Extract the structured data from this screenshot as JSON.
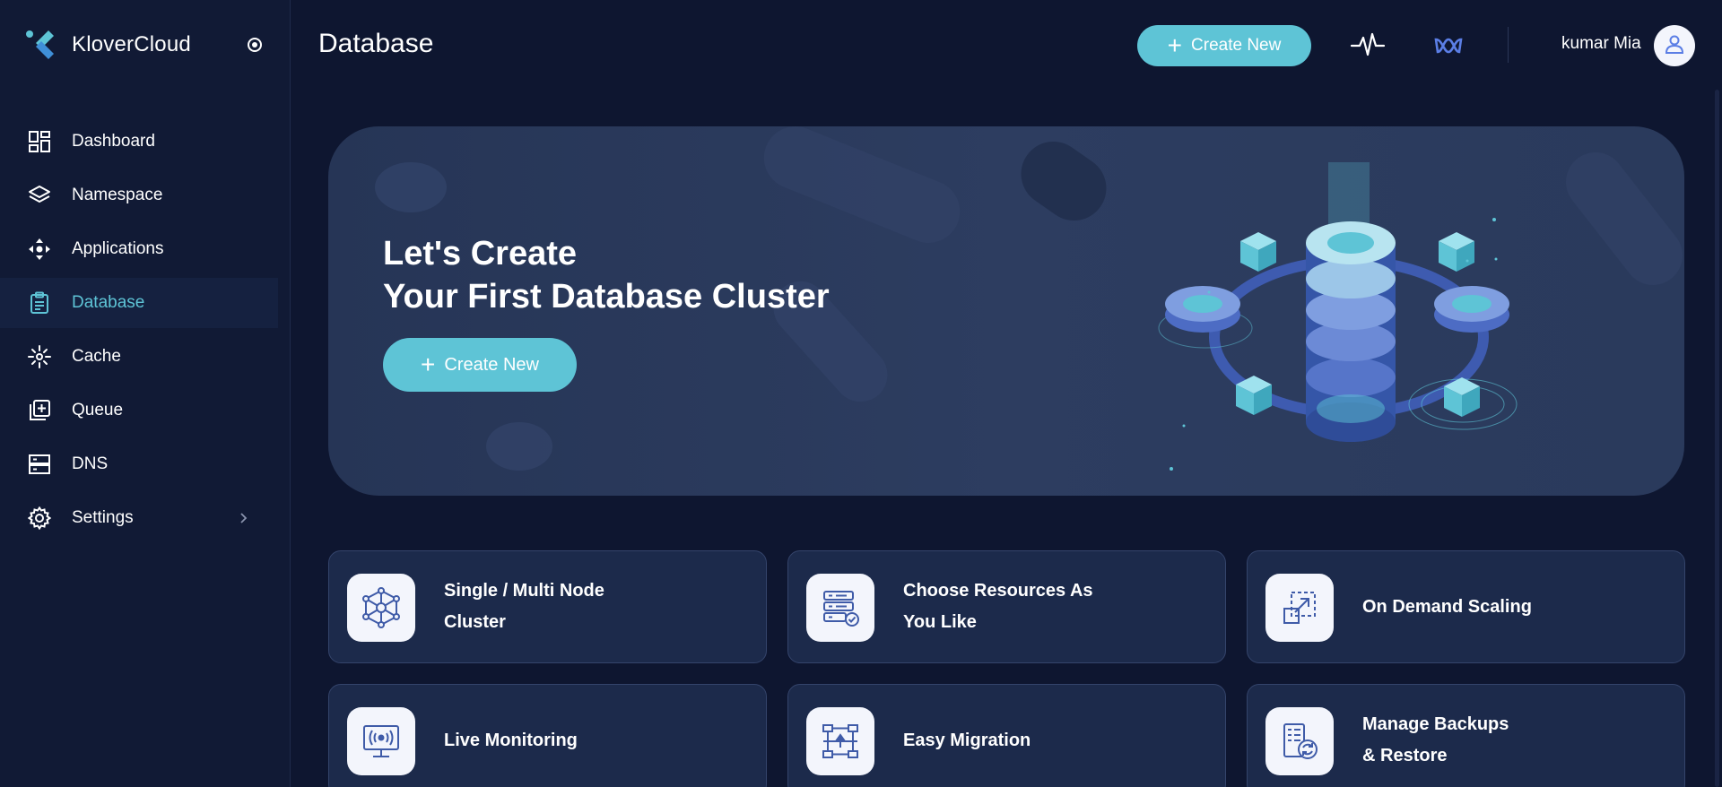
{
  "app": {
    "name": "KloverCloud"
  },
  "sidebar": {
    "items": [
      {
        "label": "Dashboard",
        "icon": "dashboard-grid-icon"
      },
      {
        "label": "Namespace",
        "icon": "layers-icon"
      },
      {
        "label": "Applications",
        "icon": "move-arrows-icon"
      },
      {
        "label": "Database",
        "icon": "clipboard-icon",
        "active": true
      },
      {
        "label": "Cache",
        "icon": "sparkle-icon"
      },
      {
        "label": "Queue",
        "icon": "queue-plus-icon"
      },
      {
        "label": "DNS",
        "icon": "server-icon"
      },
      {
        "label": "Settings",
        "icon": "gear-icon",
        "has_submenu": true
      }
    ]
  },
  "header": {
    "title": "Database",
    "create_label": "Create New",
    "user_name": "kumar Mia"
  },
  "hero": {
    "title_line1": "Let's Create",
    "title_line2": "Your First Database Cluster",
    "create_label": "Create New"
  },
  "features": [
    {
      "line1": "Single / Multi Node",
      "line2": "Cluster",
      "icon": "network-nodes-icon"
    },
    {
      "line1": "Choose Resources As",
      "line2": "You Like",
      "icon": "resource-list-check-icon"
    },
    {
      "line1": "On Demand Scaling",
      "line2": "",
      "icon": "scale-arrow-icon"
    },
    {
      "line1": "Live Monitoring",
      "line2": "",
      "icon": "monitor-broadcast-icon"
    },
    {
      "line1": "Easy Migration",
      "line2": "",
      "icon": "migration-flow-icon"
    },
    {
      "line1": "Manage Backups",
      "line2": "& Restore",
      "icon": "backup-restore-icon"
    }
  ],
  "colors": {
    "accent": "#5ec4d6",
    "background": "#0e1630",
    "sidebar": "#111a35",
    "card": "#1c2a4b"
  }
}
